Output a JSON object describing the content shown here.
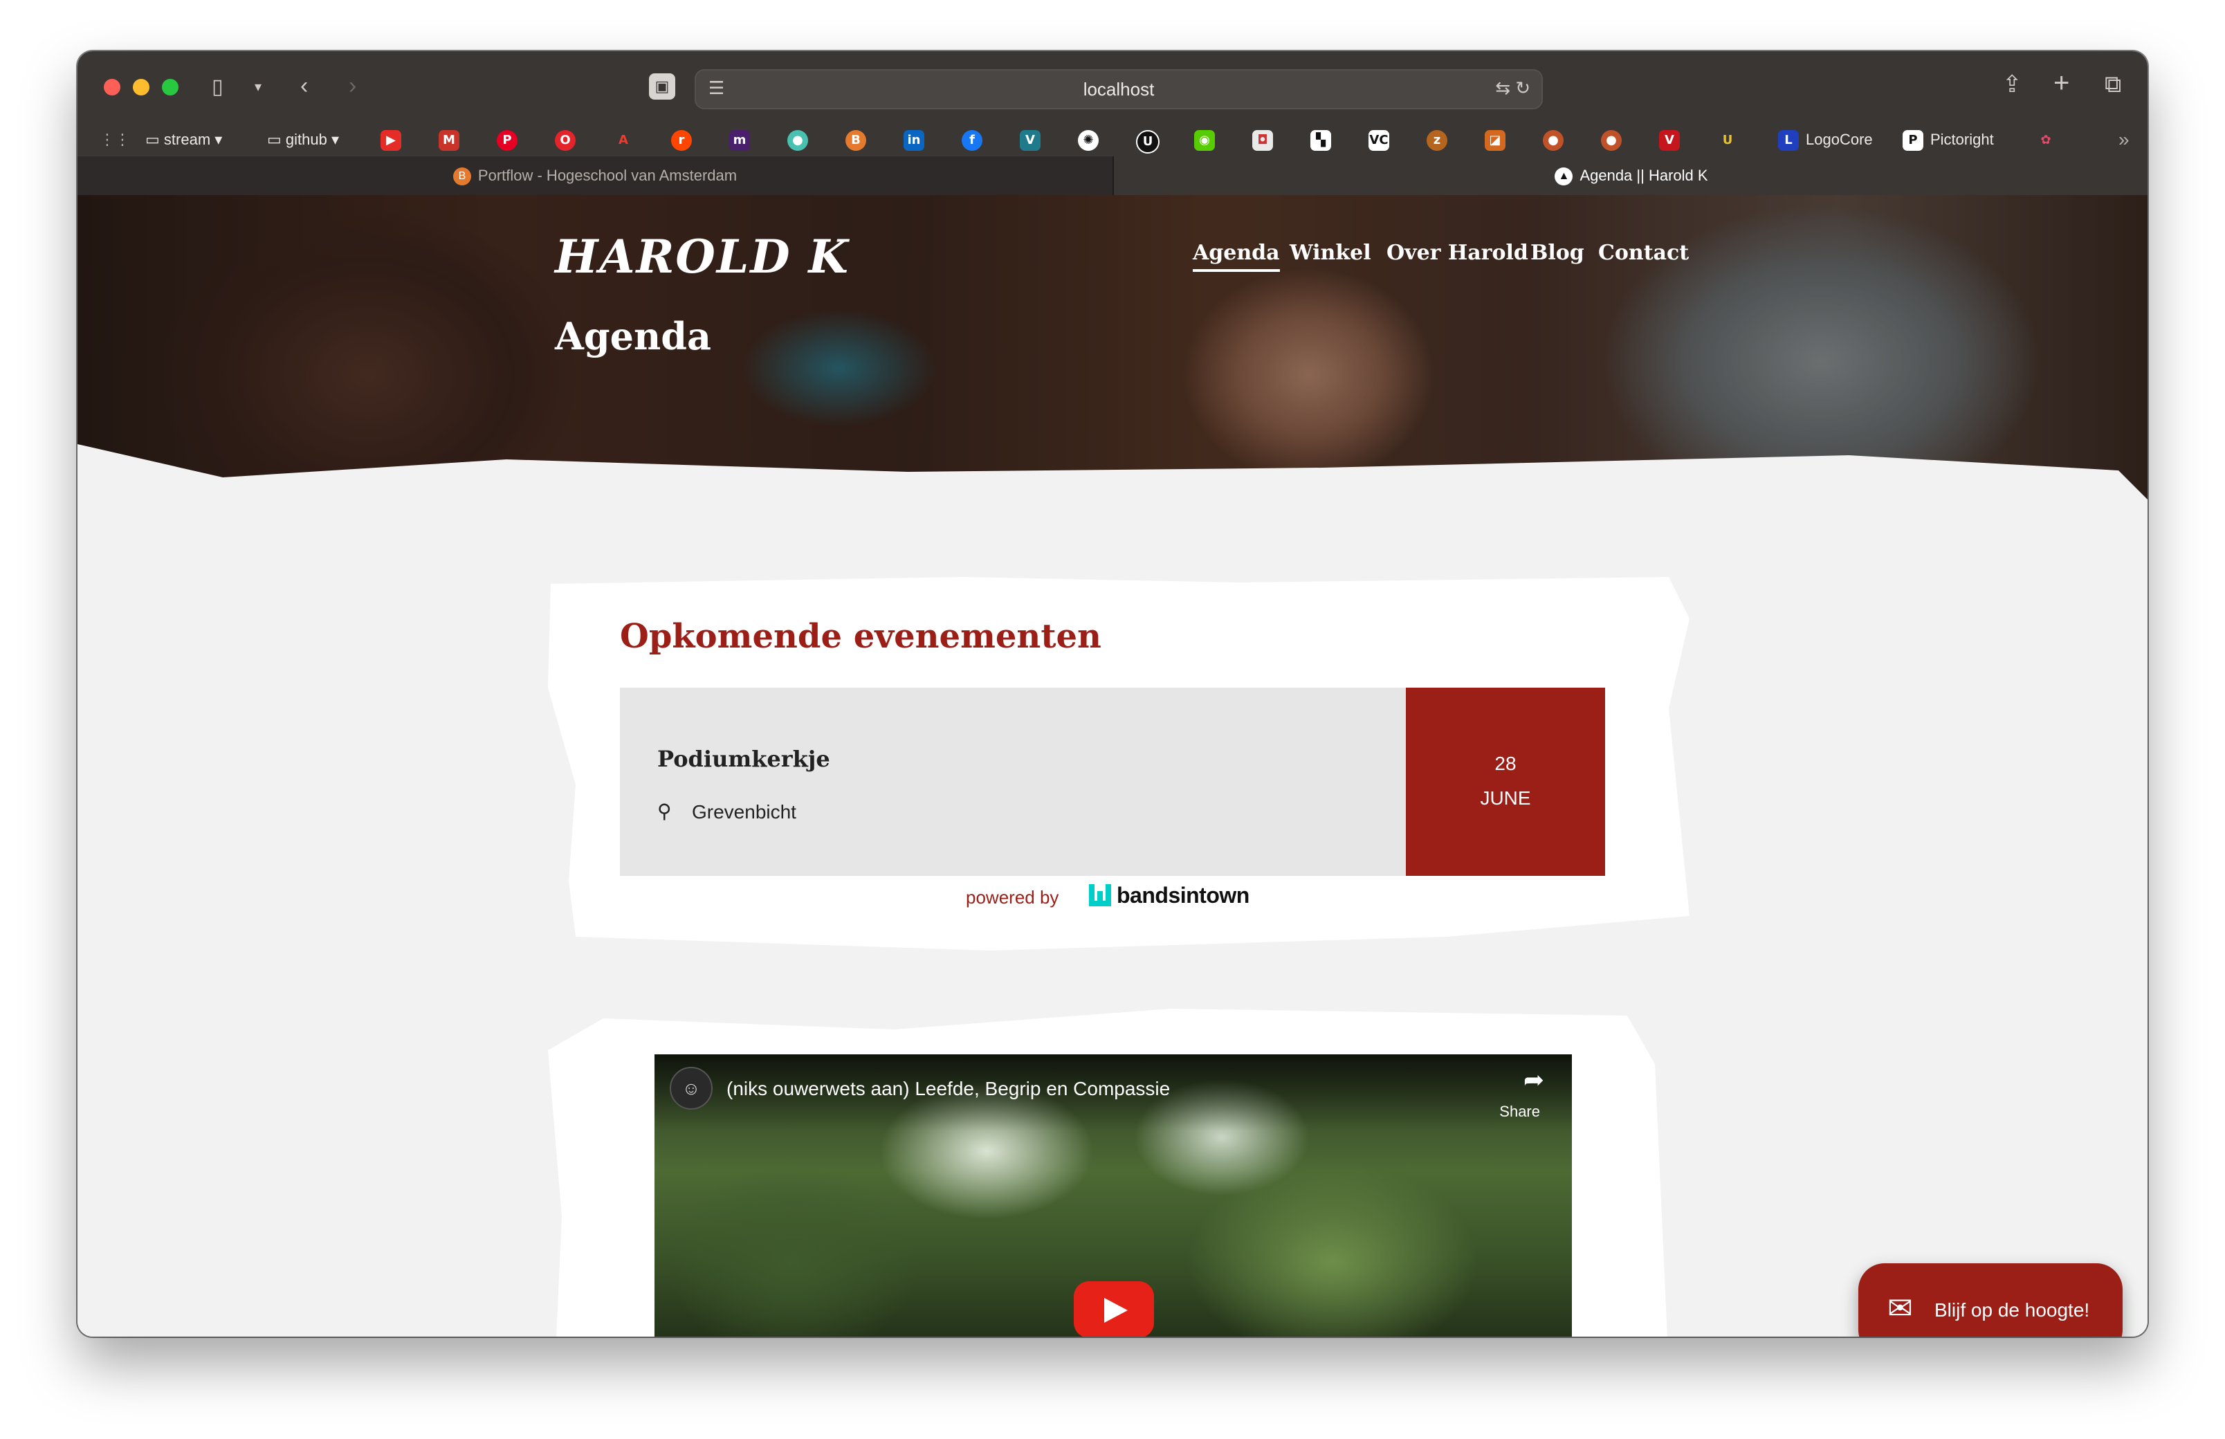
{
  "browser": {
    "url": "localhost",
    "bookmarks": {
      "folders": [
        {
          "label": "stream"
        },
        {
          "label": "github"
        }
      ],
      "named": [
        {
          "label": "LogoCore"
        },
        {
          "label": "Pictoright"
        }
      ]
    },
    "tabs": [
      {
        "label": "Portflow - Hogeschool van Amsterdam",
        "active": false
      },
      {
        "label": "Agenda || Harold K",
        "active": true
      }
    ]
  },
  "site": {
    "logo": "HAROLD K",
    "page_title": "Agenda",
    "nav": [
      {
        "label": "Agenda",
        "active": true
      },
      {
        "label": "Winkel"
      },
      {
        "label": "Over Harold"
      },
      {
        "label": "Blog"
      },
      {
        "label": "Contact"
      }
    ]
  },
  "events": {
    "title": "Opkomende evenementen",
    "items": [
      {
        "name": "Podiumkerkje",
        "location": "Grevenbicht",
        "day": "28",
        "month": "JUNE"
      }
    ],
    "powered_by": "powered by",
    "provider": "bandsintown"
  },
  "video": {
    "title": "(niks ouwerwets aan) Leefde, Begrip en Compassie",
    "share_label": "Share"
  },
  "cta": {
    "label": "Blijf op de hoogte!"
  },
  "colors": {
    "accent": "#9b1e17",
    "event_bg": "#e5e6e5",
    "page_bg": "#f1f2f1"
  }
}
